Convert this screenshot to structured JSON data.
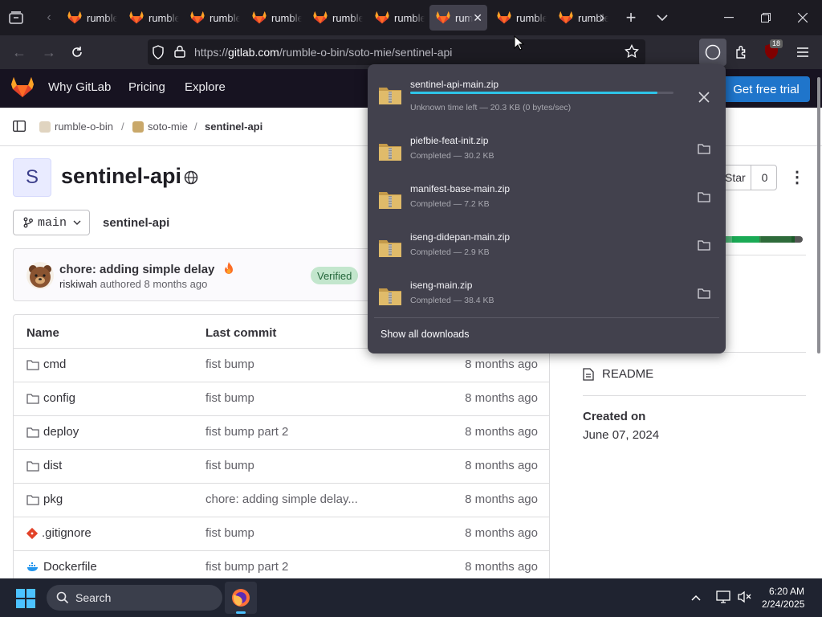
{
  "browser": {
    "tabs": [
      {
        "label": "rumble-o-bin",
        "active": false
      },
      {
        "label": "rumble-o-bin",
        "active": false
      },
      {
        "label": "rumble-o-bin",
        "active": false
      },
      {
        "label": "rumble-o-bin",
        "active": false
      },
      {
        "label": "rumble-o-bin",
        "active": false
      },
      {
        "label": "rumble-o-bin",
        "active": false
      },
      {
        "label": "rumble-o-bin",
        "active": true
      },
      {
        "label": "rumble-o-bin",
        "active": false
      },
      {
        "label": "rumble-o-bin",
        "active": false
      }
    ],
    "url_prefix": "https://",
    "url_host": "gitlab.com",
    "url_path": "/rumble-o-bin/soto-mie/sentinel-api",
    "extension_badge": "18"
  },
  "gitlab_header": {
    "nav": [
      "Why GitLab",
      "Pricing",
      "Explore"
    ],
    "trial_button": "Get free trial"
  },
  "breadcrumb": [
    "rumble-o-bin",
    "soto-mie",
    "sentinel-api"
  ],
  "project": {
    "avatar_letter": "S",
    "title": "sentinel-api",
    "branch": "main",
    "path_name": "sentinel-api",
    "star_label": "Star",
    "star_count": "0"
  },
  "commit": {
    "message": "chore: adding simple delay",
    "author": "riskiwah",
    "authored_text": "authored 8 months ago",
    "verified_badge": "Verified"
  },
  "file_table": {
    "headers": {
      "name": "Name",
      "last_commit": "Last commit"
    },
    "rows": [
      {
        "name": "cmd",
        "type": "folder",
        "commit": "fist bump",
        "date": "8 months ago"
      },
      {
        "name": "config",
        "type": "folder",
        "commit": "fist bump",
        "date": "8 months ago"
      },
      {
        "name": "deploy",
        "type": "folder",
        "commit": "fist bump part 2",
        "date": "8 months ago"
      },
      {
        "name": "dist",
        "type": "folder",
        "commit": "fist bump",
        "date": "8 months ago"
      },
      {
        "name": "pkg",
        "type": "folder",
        "commit": "chore: adding simple delay...",
        "date": "8 months ago"
      },
      {
        "name": ".gitignore",
        "type": "git",
        "commit": "fist bump",
        "date": "8 months ago"
      },
      {
        "name": "Dockerfile",
        "type": "docker",
        "commit": "fist bump part 2",
        "date": "8 months ago"
      }
    ]
  },
  "sidebar": {
    "readme": "README",
    "created_label": "Created on",
    "created_date": "June 07, 2024",
    "language_colors": [
      "#8fc7a5",
      "#52b87a",
      "#1aaa55",
      "#3b7d46",
      "#2e6b3a",
      "#1d5a2a",
      "#555555"
    ]
  },
  "downloads": {
    "items": [
      {
        "name": "sentinel-api-main.zip",
        "status": "Unknown time left — 20.3 KB (0 bytes/sec)",
        "in_progress": true,
        "progress": 0.94
      },
      {
        "name": "piefbie-feat-init.zip",
        "status": "Completed — 30.2 KB",
        "in_progress": false
      },
      {
        "name": "manifest-base-main.zip",
        "status": "Completed — 7.2 KB",
        "in_progress": false
      },
      {
        "name": "iseng-didepan-main.zip",
        "status": "Completed — 2.9 KB",
        "in_progress": false
      },
      {
        "name": "iseng-main.zip",
        "status": "Completed — 38.4 KB",
        "in_progress": false
      }
    ],
    "show_all": "Show all downloads"
  },
  "taskbar": {
    "search_placeholder": "Search",
    "time": "6:20 AM",
    "date": "2/24/2025"
  }
}
